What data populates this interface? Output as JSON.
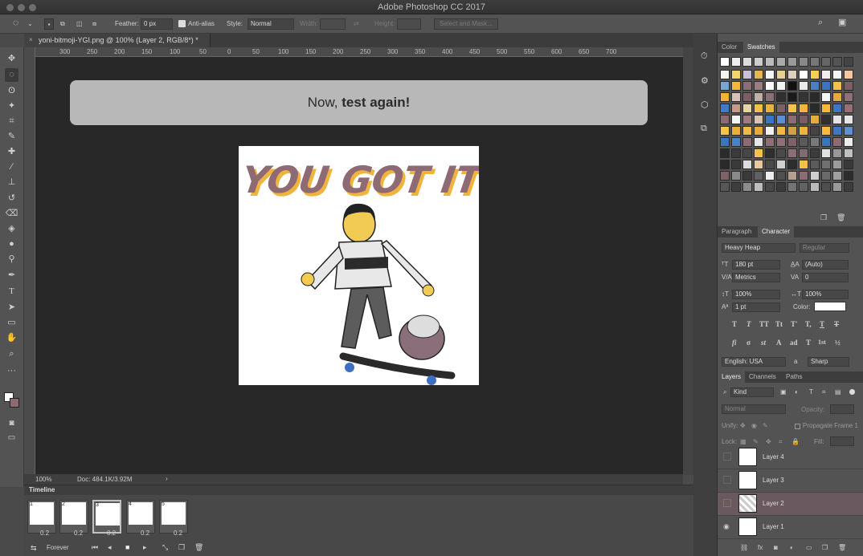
{
  "window": {
    "title": "Adobe Photoshop CC 2017"
  },
  "options": {
    "feather_label": "Feather:",
    "feather_value": "0 px",
    "antialias_label": "Anti-alias",
    "style_label": "Style:",
    "style_value": "Normal",
    "width_label": "Width:",
    "height_label": "Height:",
    "select_mask": "Select and Mask..."
  },
  "document": {
    "tab_label": "yoni-bitmoji-YGI.png @ 100% (Layer 2, RGB/8*) *",
    "zoom": "100%",
    "doc_info": "Doc: 484.1K/3.92M"
  },
  "rulers": {
    "top": [
      "300",
      "250",
      "200",
      "150",
      "100",
      "50",
      "0",
      "50",
      "100",
      "150",
      "200",
      "250",
      "300",
      "350",
      "400",
      "450",
      "500",
      "550",
      "600",
      "650",
      "700"
    ]
  },
  "banner": {
    "text_normal": "Now, ",
    "text_bold": "test again!"
  },
  "artwork": {
    "headline": "YOU GOT IT!"
  },
  "timeline": {
    "title": "Timeline",
    "loop": "Forever",
    "frames": [
      {
        "num": "1",
        "delay": "0.2"
      },
      {
        "num": "2",
        "delay": "0.2"
      },
      {
        "num": "3",
        "delay": "0.2"
      },
      {
        "num": "4",
        "delay": "0.2"
      },
      {
        "num": "5",
        "delay": "0.2"
      }
    ],
    "selected_frame": 3
  },
  "swatches_panel": {
    "tabs": [
      "Color",
      "Swatches"
    ],
    "active": "Swatches",
    "colors": [
      "#f3f3f3",
      "#f3d36d",
      "#c9c0d6",
      "#e5b54f",
      "#f5f5f5",
      "#e8d090",
      "#dccfc0",
      "#fdfdfd",
      "#f8cd55",
      "#efefef",
      "#f6f6f6",
      "#f5c7a0",
      "#77a6d6",
      "#f4b93a",
      "#8c6f74",
      "#9a7f82",
      "#f9f9f9",
      "#f2f2f2",
      "#101010",
      "#e9e9e9",
      "#4a7fc0",
      "#3d74bf",
      "#f7c04a",
      "#7d5f63",
      "#f0b237",
      "#d8c2b8",
      "#7a5f67",
      "#c2b0a8",
      "#8a7077",
      "#303030",
      "#1a1a1a",
      "#343434",
      "#2a2a2a",
      "#f5f5f5",
      "#e0ac3a",
      "#8f7278",
      "#3e7cc6",
      "#c49b87",
      "#e8d5a0",
      "#f6c045",
      "#eab040",
      "#7b6066",
      "#f8c448",
      "#f3b53b",
      "#2a2a2a",
      "#f5b93c",
      "#3d76c4",
      "#986f78",
      "#8b6b71",
      "#f5f5f5",
      "#9d7b80",
      "#d8c2b0",
      "#3b76c2",
      "#5d90d0",
      "#8c6b72",
      "#7a5d63",
      "#e3ad3e",
      "#303030",
      "#e4e4e4",
      "#e6e6e6",
      "#f6c247",
      "#eaaf3a",
      "#f2b83f",
      "#e9aa37",
      "#f1f1f1",
      "#f2ba44",
      "#d3a240",
      "#edb33d",
      "#444",
      "#f6bb3e",
      "#3e78c4",
      "#5e8fcf",
      "#3c74c0",
      "#4a81c7",
      "#8c6c72",
      "#e6e6e6",
      "#8d6f74",
      "#8e7075",
      "#7f6267",
      "#5a5a5a",
      "#797979",
      "#3a74c0",
      "#8b6c70",
      "#ededed",
      "#2b2b2b",
      "#3b3b3b",
      "#464646",
      "#f5c24b",
      "#2f2f2f",
      "#4a4a4a",
      "#8b6d73",
      "#7e6c6e",
      "#3c3c3c",
      "#e2e2e2",
      "#989898",
      "#c0c0c0",
      "#2a2a2a",
      "#3a3a3a",
      "#dddddd",
      "#e8c89e",
      "#4a4a4a",
      "#d1d1d1",
      "#2c2c2c",
      "#f4c04a",
      "#5b5b5b",
      "#707070",
      "#9c9c9c",
      "#3a3a3a",
      "#7e6268",
      "#8a8a8a",
      "#3a3a3a",
      "#606060",
      "#ededed",
      "#505050",
      "#b5a090",
      "#8b6c72",
      "#cfcfcf",
      "#6a6a6a",
      "#a0a0a0",
      "#2d2d2d",
      "#575757",
      "#3e3e3e",
      "#8c8c8c",
      "#bdbdbd",
      "#484848",
      "#3b3b3b",
      "#747474",
      "#626262",
      "#bababa",
      "#4e4e4e",
      "#9a9a9a",
      "#3d3d3d"
    ]
  },
  "character_panel": {
    "tabs": [
      "Paragraph",
      "Character"
    ],
    "active": "Character",
    "font_family": "Heavy Heap",
    "font_style": "Regular",
    "size": "180 pt",
    "leading": "(Auto)",
    "kerning": "Metrics",
    "tracking": "0",
    "vscale": "100%",
    "hscale": "100%",
    "baseline": "1 pt",
    "color_label": "Color:",
    "language": "English: USA",
    "aa_prefix": "a",
    "aa_mode": "Sharp",
    "type_buttons": [
      "T",
      "T",
      "TT",
      "Tt",
      "T'",
      "T,",
      "T",
      "T"
    ],
    "ot_buttons": [
      "fi",
      "σ",
      "st",
      "A",
      "ad",
      "T",
      "1st",
      "½"
    ]
  },
  "layers_panel": {
    "tabs": [
      "Layers",
      "Channels",
      "Paths"
    ],
    "active": "Layers",
    "filter": "Kind",
    "blend": "Normal",
    "opacity_label": "Opacity:",
    "unify_label": "Unify:",
    "propagate_label": "Propagate Frame 1",
    "lock_label": "Lock:",
    "fill_label": "Fill:",
    "layers": [
      {
        "name": "Layer 4",
        "visible": false,
        "selected": false
      },
      {
        "name": "Layer 3",
        "visible": false,
        "selected": false
      },
      {
        "name": "Layer 2",
        "visible": false,
        "selected": true
      },
      {
        "name": "Layer 1",
        "visible": true,
        "selected": false
      }
    ]
  }
}
